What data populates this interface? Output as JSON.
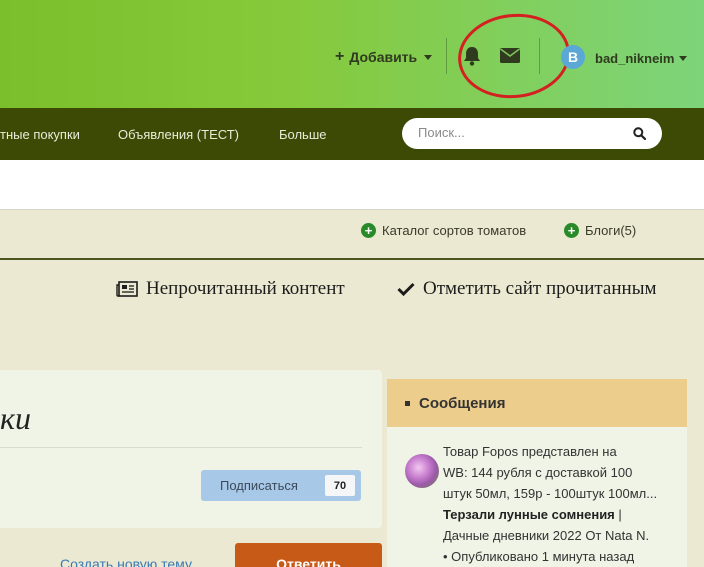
{
  "header": {
    "add_label": "Добавить",
    "username": "bad_nikneim",
    "avatar_letter": "B"
  },
  "nav": {
    "items": [
      "тные покупки",
      "Объявления (ТЕСТ)",
      "Больше"
    ],
    "search_placeholder": "Поиск..."
  },
  "quick_links": [
    "Каталог сортов томатов",
    "Блоги(5)"
  ],
  "actions": {
    "unread": "Непрочитанный контент",
    "mark_read": "Отметить сайт прочитанным"
  },
  "topic": {
    "title_fragment": "ки",
    "subscribe_label": "Подписаться",
    "subscribe_count": "70",
    "create_topic": "Создать новую тему",
    "reply": "Ответить"
  },
  "messages_widget": {
    "title": "Сообщения",
    "line1": "Товар Fopos представлен на",
    "line2": "WB: 144 рубля с доставкой 100",
    "line3": "штук 50мл, 159р - 100штук 100мл...",
    "topic_title": "Терзали лунные сомнения",
    "separator": "|",
    "blog_and_author": "Дачные дневники 2022  От Nata N.",
    "posted": "• Опубликовано 1 минута назад"
  },
  "colors": {
    "header_gradient_start": "#7cbf2c",
    "header_gradient_end": "#7dd47a",
    "navbar": "#3c4a06",
    "page_bg": "#ebe9d1",
    "reply_button": "#c85a18",
    "subscribe_button": "#a8c8e8",
    "widget_header": "#edcd8c",
    "annotation_circle": "#d42020"
  },
  "icons": [
    "plus-icon",
    "bell-icon",
    "envelope-icon",
    "search-icon",
    "newspaper-icon",
    "checkmark-icon",
    "plus-circle-icon"
  ]
}
